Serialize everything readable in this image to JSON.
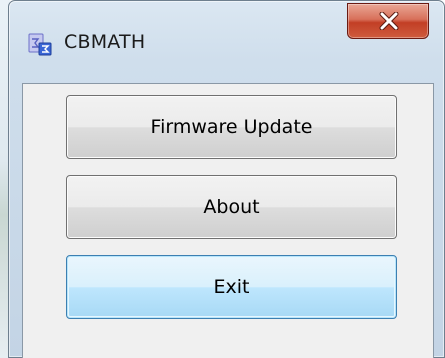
{
  "window": {
    "title": "CBMATH",
    "icon": "cbmath-app-icon",
    "close_icon": "close-icon"
  },
  "buttons": {
    "firmware_update": "Firmware Update",
    "about": "About",
    "exit": "Exit"
  },
  "colors": {
    "close_button": "#c23e25",
    "default_button_border": "#3c7fb1",
    "button_border": "#707070"
  }
}
